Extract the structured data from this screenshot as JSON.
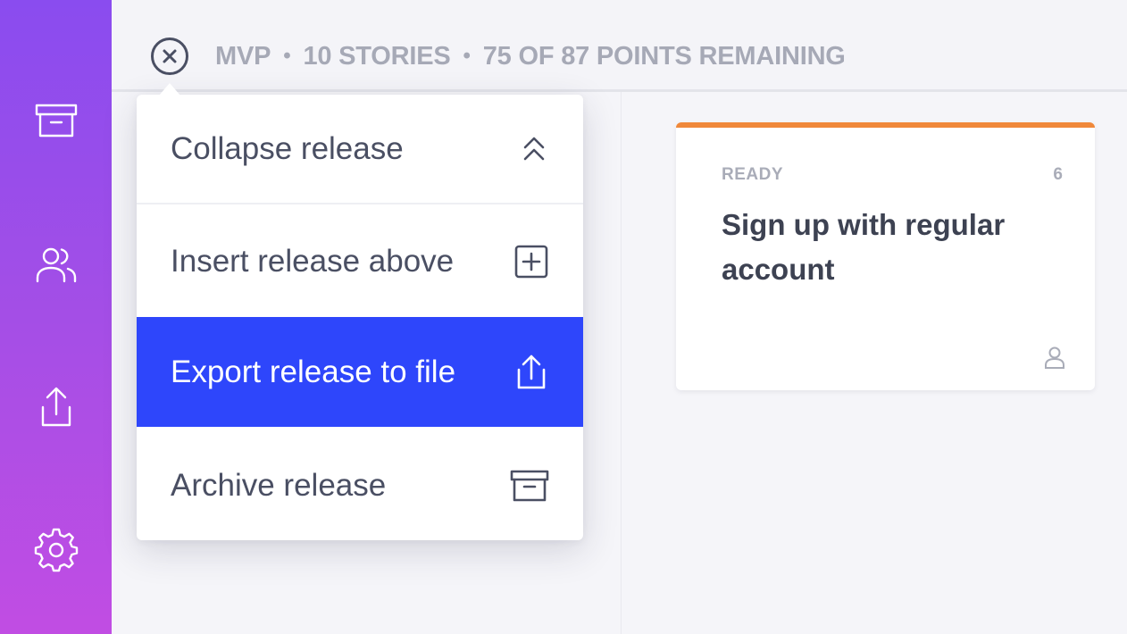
{
  "sidebar": {
    "items": [
      {
        "name": "archive",
        "icon": "archive-icon"
      },
      {
        "name": "team",
        "icon": "users-icon"
      },
      {
        "name": "export",
        "icon": "share-icon"
      },
      {
        "name": "settings",
        "icon": "gear-icon"
      }
    ]
  },
  "release": {
    "close_icon": "close-circle-icon",
    "name": "MVP",
    "separator": "•",
    "stories": "10 STORIES",
    "points": "75 OF 87 POINTS REMAINING"
  },
  "menu": {
    "items": [
      {
        "label": "Collapse release",
        "icon": "chevrons-up-icon"
      },
      {
        "label": "Insert release above",
        "icon": "plus-square-icon"
      },
      {
        "label": "Export release to file",
        "icon": "share-icon",
        "active": true
      },
      {
        "label": "Archive release",
        "icon": "archive-icon"
      }
    ]
  },
  "card": {
    "status": "READY",
    "points": "6",
    "title": "Sign up with regular account",
    "accent_color": "#f0883a",
    "assignee_icon": "user-icon"
  },
  "colors": {
    "active_menu": "#2e46fb",
    "sidebar_top": "#8a4cef",
    "sidebar_bottom": "#c14de3"
  }
}
